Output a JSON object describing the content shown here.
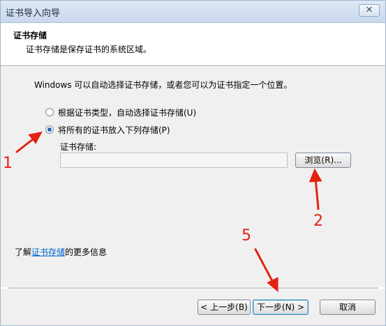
{
  "window": {
    "title": "证书导入向导",
    "close_label": "✕"
  },
  "header": {
    "title": "证书存储",
    "description": "证书存储是保存证书的系统区域。"
  },
  "body": {
    "intro": "Windows 可以自动选择证书存储，或者您可以为证书指定一个位置。",
    "radio_auto": "根据证书类型，自动选择证书存储(U)",
    "radio_manual": "将所有的证书放入下列存储(P)",
    "store_label": "证书存储:",
    "store_value": "",
    "browse_label": "浏览(R)...",
    "learn_prefix": "了解",
    "learn_link": "证书存储",
    "learn_suffix": "的更多信息"
  },
  "footer": {
    "back_label": "< 上一步(B)",
    "next_label": "下一步(N) >",
    "cancel_label": "取消"
  },
  "annotations": {
    "one": "1",
    "two": "2",
    "five": "5",
    "color": "#e32212"
  }
}
